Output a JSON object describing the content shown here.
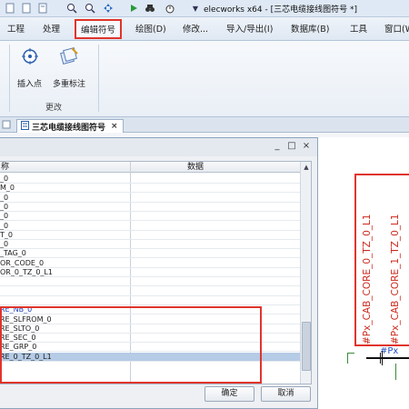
{
  "title_bar": {
    "title": "elecworks x64 - [三芯电缆接线图符号 *]",
    "quick_access_icons": [
      "document-icon",
      "document-icon",
      "document-icon",
      "zoom-in-icon",
      "zoom-out-icon",
      "pan-icon",
      "play-icon",
      "binoculars-icon",
      "stopwatch-icon",
      "dropdown-arrow-icon"
    ]
  },
  "menu": {
    "items": [
      "工程",
      "处理",
      "编辑符号",
      "绘图(D)",
      "修改...",
      "导入/导出(I)",
      "数据库(B)",
      "工具",
      "窗口(W"
    ],
    "active": "编辑符号"
  },
  "ribbon": {
    "buttons": [
      {
        "label": "插入点",
        "icon": "insert-point-icon"
      },
      {
        "label": "多重标注",
        "icon": "multi-attribute-icon"
      }
    ],
    "group_label": "更改"
  },
  "document_tab": {
    "label": "三芯电缆接线图符号",
    "close": "×"
  },
  "dialog": {
    "window_buttons": [
      "_",
      "□",
      "×"
    ],
    "columns": [
      "称",
      "数据"
    ],
    "rows": [
      {
        "name": "_0",
        "value": "",
        "style": "normal"
      },
      {
        "name": "M_0",
        "value": "",
        "style": "normal"
      },
      {
        "name": "_0",
        "value": "",
        "style": "normal"
      },
      {
        "name": "_0",
        "value": "",
        "style": "normal"
      },
      {
        "name": "_0",
        "value": "",
        "style": "normal"
      },
      {
        "name": "_0",
        "value": "",
        "style": "normal"
      },
      {
        "name": "T_0",
        "value": "",
        "style": "normal"
      },
      {
        "name": "_0",
        "value": "",
        "style": "normal"
      },
      {
        "name": "_TAG_0",
        "value": "",
        "style": "normal"
      },
      {
        "name": "OR_CODE_0",
        "value": "",
        "style": "normal"
      },
      {
        "name": "OR_0_TZ_0_L1",
        "value": "",
        "style": "normal"
      },
      {
        "name": "",
        "value": "",
        "style": "normal"
      },
      {
        "name": "",
        "value": "",
        "style": "normal"
      },
      {
        "name": "",
        "value": "",
        "style": "normal"
      },
      {
        "name": "RE_NB_0",
        "value": "",
        "style": "blue"
      },
      {
        "name": "RE_SLFROM_0",
        "value": "",
        "style": "normal"
      },
      {
        "name": "RE_SLTO_0",
        "value": "",
        "style": "normal"
      },
      {
        "name": "RE_SEC_0",
        "value": "",
        "style": "normal"
      },
      {
        "name": "RE_GRP_0",
        "value": "",
        "style": "normal"
      },
      {
        "name": "RE_0_TZ_0_L1",
        "value": "",
        "style": "selected"
      }
    ],
    "ok_label": "确定",
    "cancel_label": "取消"
  },
  "canvas": {
    "attributes": [
      "#Px_CAB_CORE_0_TZ_0_L1",
      "#Px_CAB_CORE_1_TZ_0_L1"
    ],
    "px_label": "#Px",
    "colors": {
      "attribute_text": "#cc2a1e",
      "px_label": "#2050c0",
      "highlight": "#e0342c"
    }
  }
}
